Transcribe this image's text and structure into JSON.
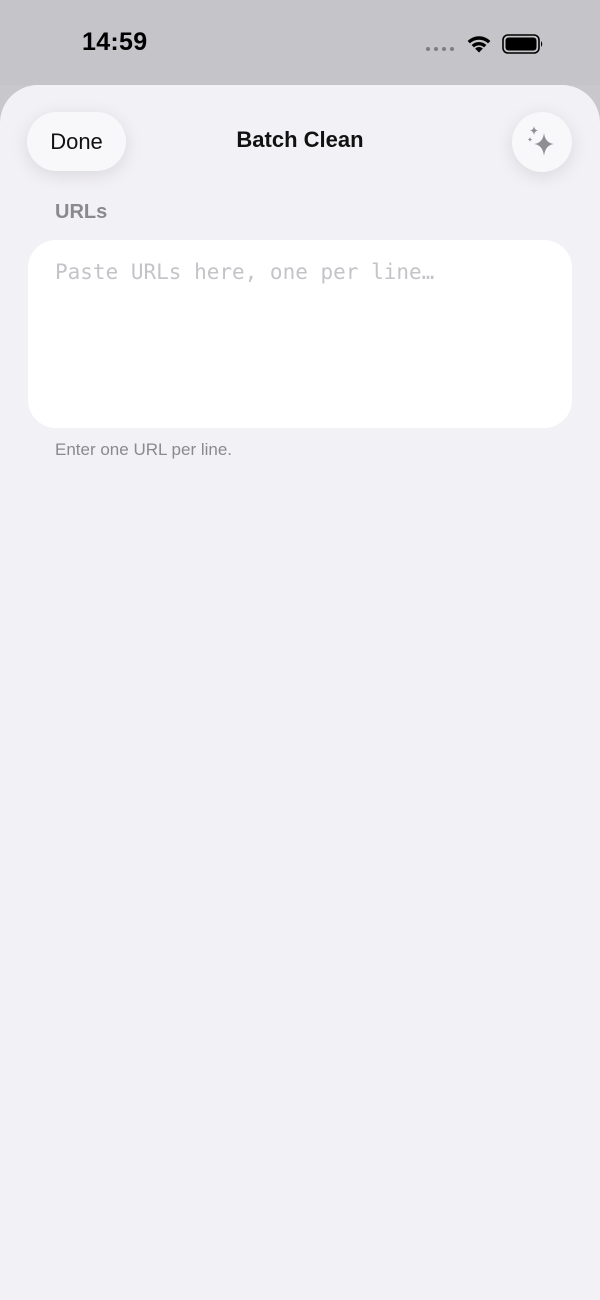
{
  "status_bar": {
    "time": "14:59"
  },
  "header": {
    "done_label": "Done",
    "title": "Batch Clean",
    "action_icon": "sparkles-icon"
  },
  "urls_section": {
    "label": "URLs",
    "placeholder": "Paste URLs here, one per line…",
    "value": "",
    "hint": "Enter one URL per line."
  },
  "colors": {
    "sheet_background": "#f2f1f6",
    "status_background": "#c5c4c9",
    "secondary_text": "#8a8a8e",
    "placeholder": "#c4c4c8"
  }
}
